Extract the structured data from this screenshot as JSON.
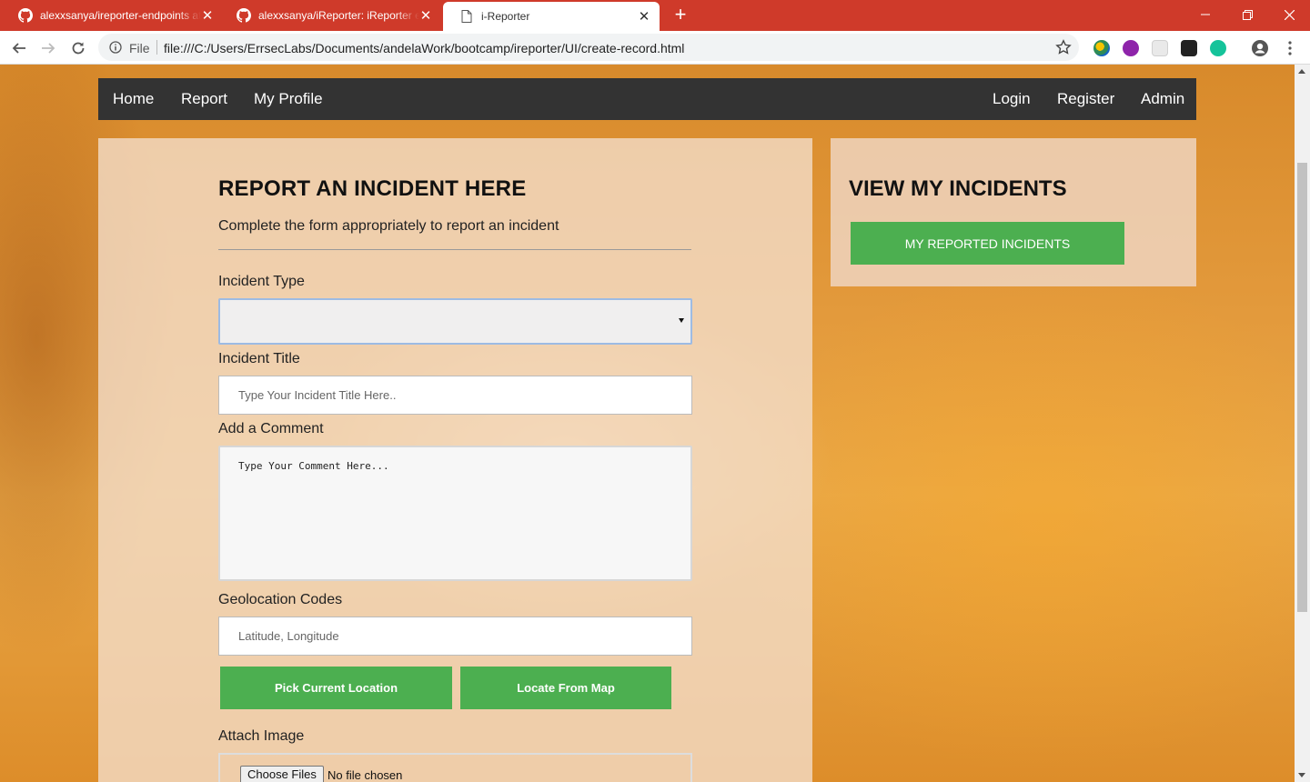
{
  "browser": {
    "tabs": [
      {
        "title": "alexxsanya/ireporter-endpoints at",
        "active": false
      },
      {
        "title": "alexxsanya/iReporter: iReporter en",
        "active": false
      },
      {
        "title": "i-Reporter",
        "active": true
      }
    ],
    "new_tab": "+",
    "close_glyph": "✕",
    "address": {
      "scheme_label": "File",
      "url": "file:///C:/Users/ErrsecLabs/Documents/andelaWork/bootcamp/ireporter/UI/create-record.html"
    },
    "colors": {
      "tabbar": "#cf3a2a"
    }
  },
  "nav": {
    "left": [
      "Home",
      "Report",
      "My Profile"
    ],
    "right": [
      "Login",
      "Register",
      "Admin"
    ]
  },
  "form": {
    "heading": "REPORT AN INCIDENT HERE",
    "subtitle": "Complete the form appropriately to report an incident",
    "incident_type_label": "Incident Type",
    "incident_type_value": "",
    "title_label": "Incident Title",
    "title_placeholder": "Type Your Incident Title Here..",
    "comment_label": "Add a Comment",
    "comment_placeholder": "Type Your Comment Here...",
    "geo_label": "Geolocation Codes",
    "geo_placeholder": "Latitude, Longitude",
    "pick_location_button": "Pick Current Location",
    "locate_map_button": "Locate From Map",
    "attach_label": "Attach Image",
    "choose_files_button": "Choose Files",
    "file_status": "No file chosen"
  },
  "sidebar": {
    "heading": "VIEW MY INCIDENTS",
    "reported_button": "MY REPORTED INCIDENTS"
  },
  "colors": {
    "accent_green": "#4caf50",
    "nav_bg": "#333333"
  }
}
